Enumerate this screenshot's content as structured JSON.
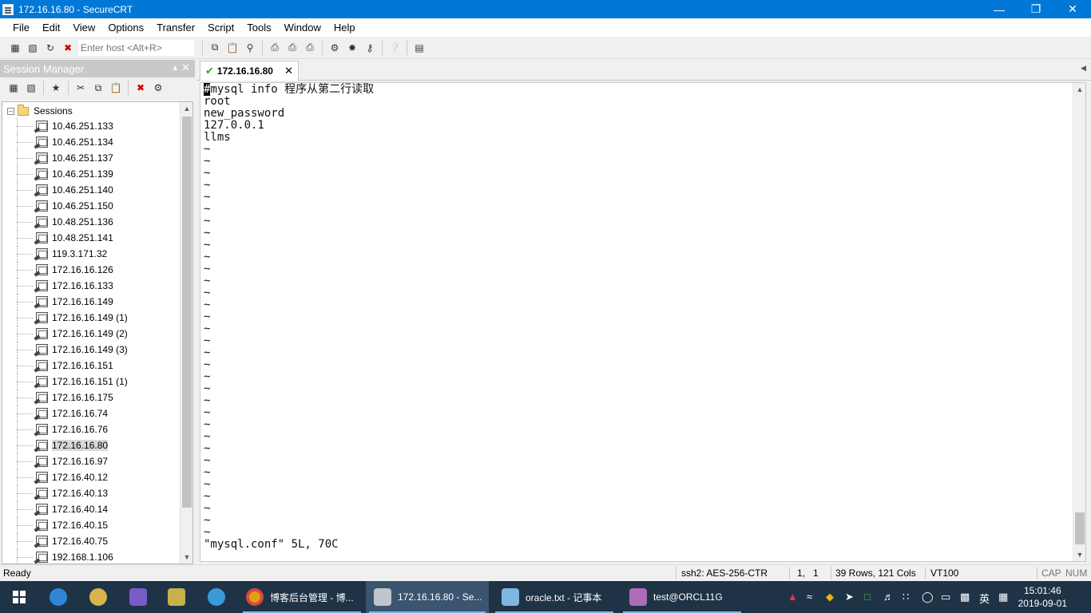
{
  "window": {
    "title": "172.16.16.80 - SecureCRT"
  },
  "menu": [
    "File",
    "Edit",
    "View",
    "Options",
    "Transfer",
    "Script",
    "Tools",
    "Window",
    "Help"
  ],
  "toolbar": {
    "host_placeholder": "Enter host <Alt+R>"
  },
  "session_manager": {
    "title": "Session Manager",
    "root": "Sessions",
    "selected": "172.16.16.80",
    "items": [
      "10.46.251.133",
      "10.46.251.134",
      "10.46.251.137",
      "10.46.251.139",
      "10.46.251.140",
      "10.46.251.150",
      "10.48.251.136",
      "10.48.251.141",
      "119.3.171.32",
      "172.16.16.126",
      "172.16.16.133",
      "172.16.16.149",
      "172.16.16.149 (1)",
      "172.16.16.149 (2)",
      "172.16.16.149 (3)",
      "172.16.16.151",
      "172.16.16.151 (1)",
      "172.16.16.175",
      "172.16.16.74",
      "172.16.16.76",
      "172.16.16.80",
      "172.16.16.97",
      "172.16.40.12",
      "172.16.40.13",
      "172.16.40.14",
      "172.16.40.15",
      "172.16.40.75",
      "192.168.1.106"
    ]
  },
  "tab": {
    "label": "172.16.16.80"
  },
  "terminal": {
    "first_char": "#",
    "first_rest": "mysql info 程序从第二行读取",
    "lines": [
      "root",
      "new_password",
      "127.0.0.1",
      "llms"
    ],
    "tilde_count": 33,
    "status_line": "\"mysql.conf\" 5L, 70C"
  },
  "statusbar": {
    "ready": "Ready",
    "cipher": "ssh2: AES-256-CTR",
    "position": "1,   1",
    "size": "39 Rows, 121 Cols",
    "term": "VT100",
    "cap": "CAP",
    "num": "NUM"
  },
  "taskbar": {
    "apps": [
      {
        "label": "博客后台管理 - 博...",
        "icon": "chrome-icon"
      },
      {
        "label": "172.16.16.80 - Se...",
        "icon": "securecrt-icon"
      },
      {
        "label": "oracle.txt - 记事本",
        "icon": "notepad-icon"
      },
      {
        "label": "test@ORCL11G",
        "icon": "database-icon"
      }
    ],
    "ime": "英",
    "time": "15:01:46",
    "date": "2019-09-01"
  }
}
